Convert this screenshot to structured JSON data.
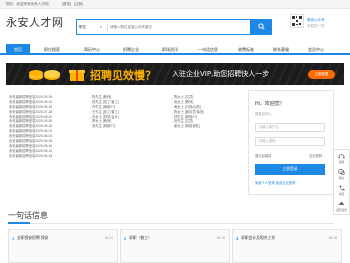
{
  "topbar": {
    "greeting": "您好，欢迎来到永安人才网！",
    "login": "[登录]",
    "register": "[注册]"
  },
  "header": {
    "logo": "永安人才网",
    "search": {
      "city": "职位",
      "placeholder": "请输入职位或者公司关键字"
    },
    "qr": {
      "line1": "微信公众号",
      "line2": "手机扫一扫"
    }
  },
  "nav": {
    "items": [
      {
        "label": "首页",
        "active": true
      },
      {
        "label": "职位搜索"
      },
      {
        "label": "简历中心"
      },
      {
        "label": "招聘企业"
      },
      {
        "label": "职场资讯"
      },
      {
        "label": "一句话信息"
      },
      {
        "label": "收费标准"
      },
      {
        "label": "联系客服"
      },
      {
        "label": "会员中心"
      }
    ]
  },
  "banner": {
    "title": "招聘见效慢？",
    "subtitle": "入驻企业VIP,助您招聘快人一步",
    "button": "立即查看"
  },
  "lists": {
    "col1": [
      "永安最新招聘信息2025-05-09",
      "永安最新招聘信息2025-05-10",
      "永安最新招聘信息2025-05-25",
      "永安最新招聘信息2025-07-28",
      "永安最新招聘信息2025-05-20",
      "永安最新招聘信息2025-05-30",
      "永安最新招聘信息2025-05-16",
      "永安最新招聘信息2025-06-01",
      "永安最新招聘信息2025-06-02",
      "永安最新招聘信息2025-06-05",
      "永安最新招聘信息2025-06-06",
      "永安最新招聘信息2025-06-10",
      "永安最新招聘信息2025-06-15"
    ],
    "col2": [
      "- 陈先生 [教师]",
      "- 张先生 [技工/普工]",
      "- 许先生 [网络/IT]",
      "- 王先生 [技工/普工]",
      "- 刘女士 [财务/会计]",
      "- 罗女士 [教师]",
      "- 张先生 [网络/IT]"
    ],
    "col3": [
      "- 陈女士 [文员]",
      "- 吴女士 [教师]",
      "- 黄女士 [行政/后勤]",
      "- 陈女士 [服务员/保安]",
      "- 林先生 [网络/IT]",
      "- 张先生 [文员]",
      "- 谢女士 [网络销售]"
    ]
  },
  "login": {
    "greeting": "Hi，欢迎您！",
    "sub": "登录后可以",
    "username_placeholder": "请输入用户名",
    "password_placeholder": "请输入密码",
    "remember": "登记后保持",
    "forget": "忘记密码",
    "button": "立即登录",
    "register": "免费个人登录 免费企业登录"
  },
  "sidebar": {
    "items": [
      {
        "label": "客服"
      },
      {
        "label": "微信"
      },
      {
        "label": "电话"
      },
      {
        "label": "返回顶部"
      }
    ]
  },
  "section": {
    "title": "一句话信息"
  },
  "cards": [
    {
      "num": "1",
      "title": "全职保安招聘 保安",
      "date": "06-21"
    },
    {
      "num": "2",
      "title": "求职（普工）",
      "date": "06-19"
    },
    {
      "num": "3",
      "title": "求职会计及相关工作",
      "date": "06-18"
    }
  ]
}
